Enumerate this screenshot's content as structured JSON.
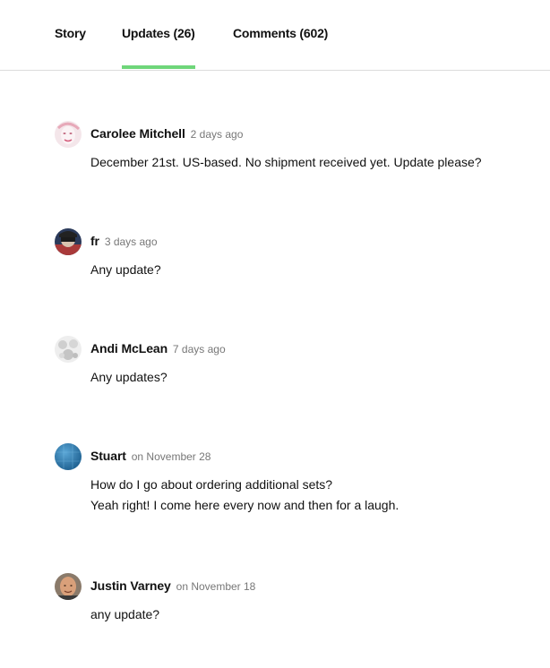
{
  "tabs": [
    {
      "label": "Story"
    },
    {
      "label": "Updates (26)"
    },
    {
      "label": "Comments (602)"
    }
  ],
  "active_tab_color": "#6fd67a",
  "comments": [
    {
      "author": "Carolee Mitchell",
      "time": "2 days ago",
      "lines": [
        "December 21st. US-based. No shipment received yet. Update please?"
      ],
      "avatar": "portrait-pink-avatar"
    },
    {
      "author": "fr",
      "time": "3 days ago",
      "lines": [
        "Any update?"
      ],
      "avatar": "masked-figure-avatar"
    },
    {
      "author": "Andi McLean",
      "time": "7 days ago",
      "lines": [
        "Any updates?"
      ],
      "avatar": "sketch-faces-avatar"
    },
    {
      "author": "Stuart",
      "time": "on November 28",
      "lines": [
        "How do I go about ordering additional sets?",
        "Yeah right! I come here every now and then for a laugh."
      ],
      "avatar": "blue-globe-avatar"
    },
    {
      "author": "Justin Varney",
      "time": "on November 18",
      "lines": [
        "any update?"
      ],
      "avatar": "bald-man-avatar"
    }
  ]
}
